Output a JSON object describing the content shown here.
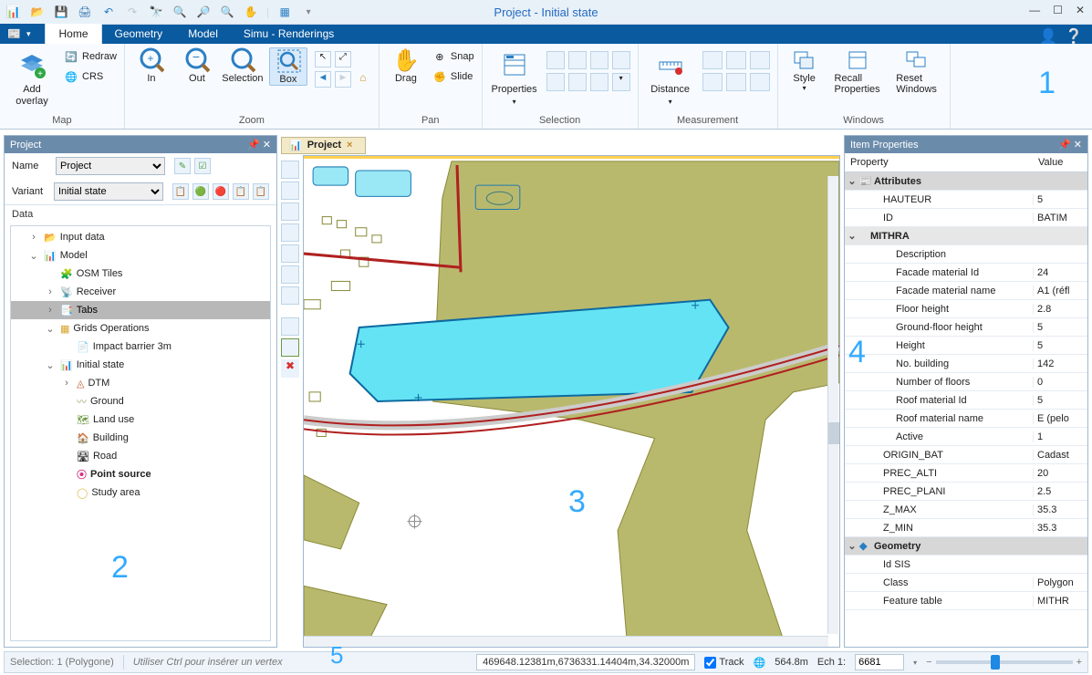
{
  "window": {
    "title": "Project - Initial state"
  },
  "menu_tabs": {
    "home": "Home",
    "geometry": "Geometry",
    "model": "Model",
    "simu": "Simu - Renderings"
  },
  "ribbon": {
    "map": {
      "group": "Map",
      "add_overlay": "Add\noverlay",
      "redraw": "Redraw",
      "crs": "CRS"
    },
    "zoom": {
      "group": "Zoom",
      "in": "In",
      "out": "Out",
      "selection": "Selection",
      "box": "Box"
    },
    "pan": {
      "group": "Pan",
      "drag": "Drag",
      "snap": "Snap",
      "slide": "Slide"
    },
    "selection": {
      "group": "Selection",
      "properties": "Properties"
    },
    "measurement": {
      "group": "Measurement",
      "distance": "Distance"
    },
    "windows": {
      "group": "Windows",
      "style": "Style",
      "recall": "Recall\nProperties",
      "reset": "Reset\nWindows"
    }
  },
  "project_panel": {
    "title": "Project",
    "name_label": "Name",
    "name_value": "Project",
    "variant_label": "Variant",
    "variant_value": "Initial state",
    "data_label": "Data",
    "tree": {
      "input_data": "Input data",
      "model": "Model",
      "osm": "OSM Tiles",
      "receiver": "Receiver",
      "tabs": "Tabs",
      "grids": "Grids Operations",
      "impact": "Impact barrier 3m",
      "initial": "Initial state",
      "dtm": "DTM",
      "ground": "Ground",
      "landuse": "Land use",
      "building": "Building",
      "road": "Road",
      "point_source": "Point source",
      "study_area": "Study area"
    }
  },
  "map_tab": {
    "label": "Project"
  },
  "props_panel": {
    "title": "Item Properties",
    "col_property": "Property",
    "col_value": "Value",
    "rows": {
      "attributes": "Attributes",
      "hauteur_k": "HAUTEUR",
      "hauteur_v": "5",
      "id_k": "ID",
      "id_v": "BATIM",
      "mithra": "MITHRA",
      "desc_k": "Description",
      "desc_v": "",
      "facid_k": "Facade material Id",
      "facid_v": "24",
      "facname_k": "Facade material name",
      "facname_v": "A1 (réfl",
      "floorh_k": "Floor height",
      "floorh_v": "2.8",
      "gfh_k": "Ground-floor height",
      "gfh_v": "5",
      "height_k": "Height",
      "height_v": "5",
      "nobld_k": "No. building",
      "nobld_v": "142",
      "nfloors_k": "Number of floors",
      "nfloors_v": "0",
      "roofid_k": "Roof material Id",
      "roofid_v": "5",
      "roofname_k": "Roof material name",
      "roofname_v": "E (pelo",
      "active_k": "Active",
      "active_v": "1",
      "origin_k": "ORIGIN_BAT",
      "origin_v": "Cadast",
      "precalt_k": "PREC_ALTI",
      "precalt_v": "20",
      "precplan_k": "PREC_PLANI",
      "precplan_v": "2.5",
      "zmax_k": "Z_MAX",
      "zmax_v": "35.3",
      "zmin_k": "Z_MIN",
      "zmin_v": "35.3",
      "geometry": "Geometry",
      "idsis_k": "Id SIS",
      "idsis_v": "",
      "class_k": "Class",
      "class_v": "Polygon",
      "ftable_k": "Feature table",
      "ftable_v": "MITHR"
    }
  },
  "status": {
    "selection": "Selection: 1 (Polygone)",
    "hint": "Utiliser Ctrl pour insérer un vertex",
    "coords": "469648.12381m,6736331.14404m,34.32000m",
    "track": "Track",
    "dist": "564.8m",
    "scale_label": "Ech 1:",
    "scale_value": "6681"
  },
  "annotations": {
    "n1": "1",
    "n2": "2",
    "n3": "3",
    "n4": "4",
    "n5": "5"
  }
}
